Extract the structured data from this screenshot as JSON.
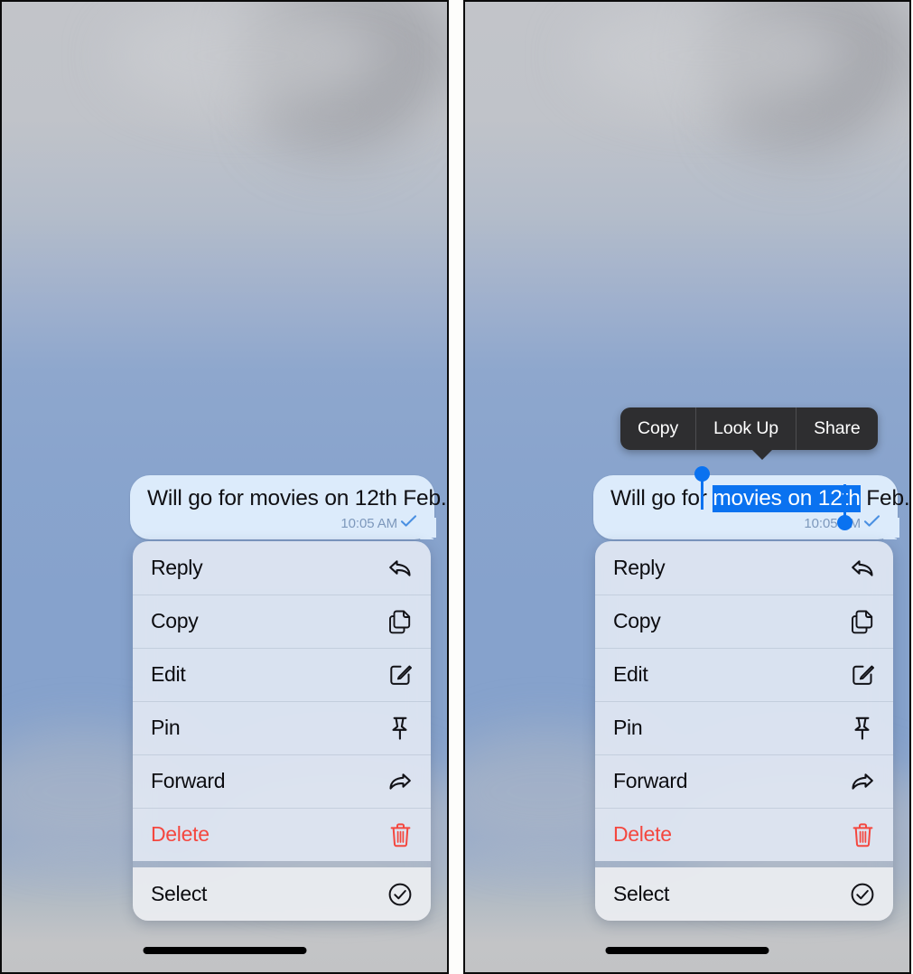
{
  "panels": [
    {
      "id": "left",
      "name": "message-context-menu-panel",
      "message": {
        "text": "Will go for movies on 12th Feb.",
        "time": "10:05 AM",
        "delivery_icon": "checkmark-icon",
        "bubble_color": "#dcebfb",
        "time_color": "#7d98bc"
      },
      "selection": null,
      "callout": null
    },
    {
      "id": "right",
      "name": "text-selection-panel",
      "message": {
        "text": "Will go for movies on 12th Feb.",
        "text_before": "Will go for ",
        "text_selected": "movies on 12th",
        "text_after": " Feb.",
        "time": "10:05 AM",
        "delivery_icon": "checkmark-icon",
        "bubble_color": "#dcebfb",
        "time_color": "#7d98bc"
      },
      "selection": {
        "highlight_color": "#0a72f0",
        "handle_color": "#0a72f0",
        "start_handle_name": "selection-handle-start",
        "end_handle_name": "selection-handle-end"
      },
      "callout": {
        "background": "#2e2e30",
        "items": [
          {
            "label": "Copy",
            "name": "callout-item-copy"
          },
          {
            "label": "Look Up",
            "name": "callout-item-look-up"
          },
          {
            "label": "Share",
            "name": "callout-item-share"
          }
        ]
      }
    }
  ],
  "context_menu": {
    "primary": [
      {
        "label": "Reply",
        "icon": "reply-arrow-icon",
        "destructive": false
      },
      {
        "label": "Copy",
        "icon": "copy-pages-icon",
        "destructive": false
      },
      {
        "label": "Edit",
        "icon": "pencil-square-icon",
        "destructive": false
      },
      {
        "label": "Pin",
        "icon": "pushpin-icon",
        "destructive": false
      },
      {
        "label": "Forward",
        "icon": "forward-arrow-icon",
        "destructive": false
      },
      {
        "label": "Delete",
        "icon": "trash-icon",
        "destructive": true
      }
    ],
    "secondary": [
      {
        "label": "Select",
        "icon": "check-circle-icon",
        "destructive": false
      }
    ],
    "destructive_color": "#f4473f",
    "label_color": "#0c0c10"
  },
  "home_indicator": {
    "name": "home-indicator"
  }
}
